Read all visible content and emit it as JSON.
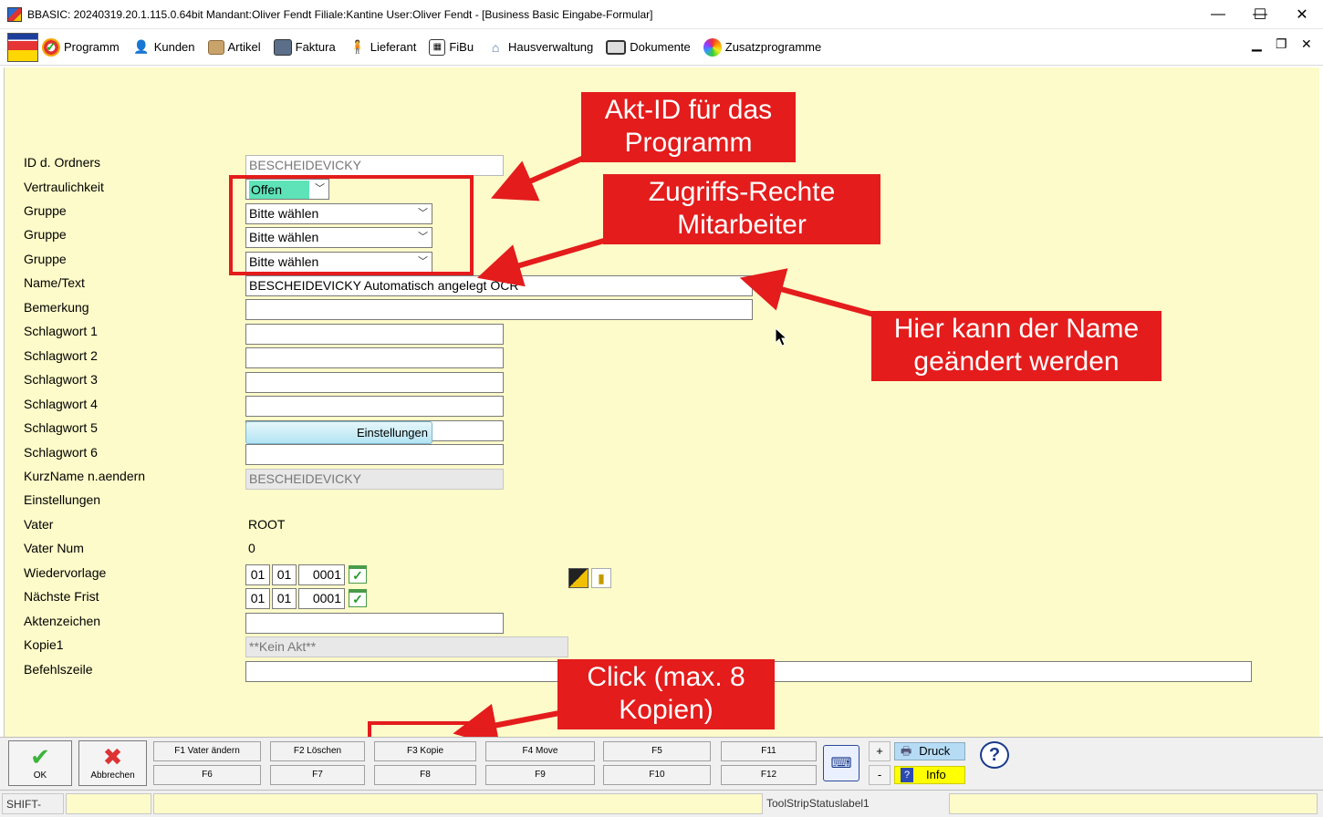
{
  "window": {
    "title": "BBASIC: 20240319.20.1.115.0.64bit Mandant:Oliver Fendt Filiale:Kantine User:Oliver Fendt - [Business Basic Eingabe-Formular]",
    "minimize": "—",
    "maximize": "☐",
    "close": "✕"
  },
  "menu": {
    "items": [
      {
        "label": "Programm",
        "icon": "program-icon"
      },
      {
        "label": "Kunden",
        "icon": "customers-icon"
      },
      {
        "label": "Artikel",
        "icon": "articles-icon"
      },
      {
        "label": "Faktura",
        "icon": "invoice-icon"
      },
      {
        "label": "Lieferant",
        "icon": "supplier-icon"
      },
      {
        "label": "FiBu",
        "icon": "accounting-icon"
      },
      {
        "label": "Hausverwaltung",
        "icon": "property-icon"
      },
      {
        "label": "Dokumente",
        "icon": "documents-icon"
      },
      {
        "label": "Zusatzprogramme",
        "icon": "addons-icon"
      }
    ],
    "mdi_min": "▁",
    "mdi_restore": "❐",
    "mdi_close": "✕"
  },
  "form": {
    "labels": {
      "id_ordner": "ID d. Ordners",
      "vertraulichkeit": "Vertraulichkeit",
      "gruppe1": "Gruppe",
      "gruppe2": "Gruppe",
      "gruppe3": "Gruppe",
      "name_text": "Name/Text",
      "bemerkung": "Bemerkung",
      "schlagwort1": "Schlagwort 1",
      "schlagwort2": "Schlagwort 2",
      "schlagwort3": "Schlagwort 3",
      "schlagwort4": "Schlagwort 4",
      "schlagwort5": "Schlagwort 5",
      "schlagwort6": "Schlagwort 6",
      "kurzname": "KurzName n.aendern",
      "einstellungen": "Einstellungen",
      "vater": "Vater",
      "vater_num": "Vater Num",
      "wiedervorlage": "Wiedervorlage",
      "naechste_frist": "Nächste Frist",
      "aktenzeichen": "Aktenzeichen",
      "kopie1": "Kopie1",
      "befehlszeile": "Befehlszeile"
    },
    "values": {
      "id_ordner": "BESCHEIDEVICKY",
      "vertraulichkeit": "Offen",
      "gruppe1": "Bitte wählen",
      "gruppe2": "Bitte wählen",
      "gruppe3": "Bitte wählen",
      "name_text": "BESCHEIDEVICKY Automatisch angelegt OCR",
      "bemerkung": "",
      "schlagwort1": "",
      "schlagwort2": "",
      "schlagwort3": "",
      "schlagwort4": "",
      "schlagwort5": "",
      "schlagwort6": "",
      "kurzname": "BESCHEIDEVICKY",
      "einstellungen_button": "Einstellungen",
      "vater": "ROOT",
      "vater_num": "0",
      "wiedervorlage": {
        "day": "01",
        "month": "01",
        "year": "0001"
      },
      "naechste_frist": {
        "day": "01",
        "month": "01",
        "year": "0001"
      },
      "aktenzeichen": "",
      "kopie1": "**Kein Akt**",
      "befehlszeile": ""
    }
  },
  "annotations": {
    "akt_id": "Akt-ID für das Programm",
    "akt_id_line1": "Akt-ID für das",
    "akt_id_line2": "Programm",
    "rechte_line1": "Zugriffs-Rechte",
    "rechte_line2": "Mitarbeiter",
    "name_line1": "Hier kann der Name",
    "name_line2": "geändert werden",
    "click_line1": "Click (max. 8",
    "click_line2": "Kopien)"
  },
  "function_bar": {
    "ok": "OK",
    "abbrechen": "Abbrechen",
    "f1": "F1 Vater ändern",
    "f2": "F2 Löschen",
    "f3": "F3 Kopie",
    "f4": "F4 Move",
    "f5": "F5",
    "f6": "F6",
    "f7": "F7",
    "f8": "F8",
    "f9": "F9",
    "f10": "F10",
    "f11": "F11",
    "f12": "F12",
    "plus": "+",
    "minus": "-",
    "druck": "Druck",
    "info": "Info"
  },
  "statusbar": {
    "shift": "SHIFT-Taste",
    "label1": "ToolStripStatuslabel1"
  },
  "colors": {
    "form_bg": "#fdfbc9",
    "annotation_red": "#e41c1c",
    "selected_combo": "#5ee3b9",
    "info_yellow": "#ffff00",
    "druck_blue": "#b6dcf5"
  }
}
